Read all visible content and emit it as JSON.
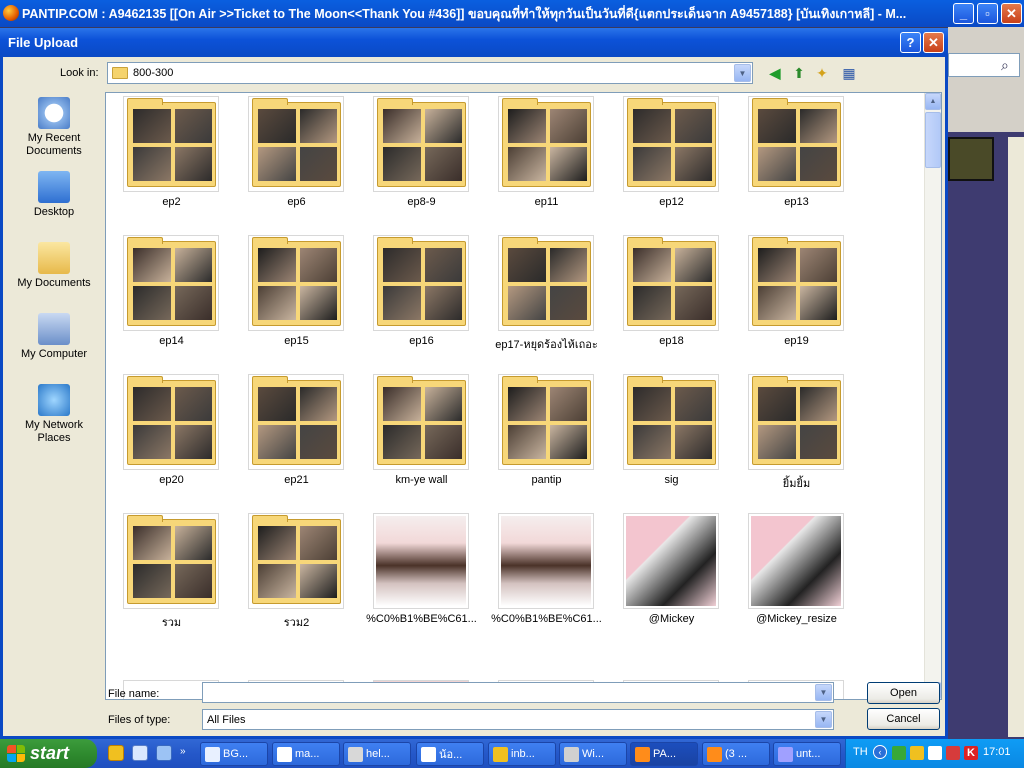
{
  "browser": {
    "title": "PANTIP.COM : A9462135 [[On Air >>Ticket to The Moon<<Thank You #436]] ขอบคุณที่ทำให้ทุกวันเป็นวันที่ดี{แตกประเด็นจาก A9457188} [บันเทิงเกาหลี] - M..."
  },
  "dialog": {
    "title": "File Upload",
    "help_btn": "?",
    "close_btn": "✕",
    "look_in_label": "Look in:",
    "look_in_value": "800-300",
    "file_name_label": "File name:",
    "file_name_value": "",
    "files_of_type_label": "Files of type:",
    "files_of_type_value": "All Files",
    "open_btn": "Open",
    "cancel_btn": "Cancel"
  },
  "places": [
    {
      "label": "My Recent Documents",
      "icon": "recent-documents-icon"
    },
    {
      "label": "Desktop",
      "icon": "desktop-icon"
    },
    {
      "label": "My Documents",
      "icon": "my-documents-icon"
    },
    {
      "label": "My Computer",
      "icon": "my-computer-icon"
    },
    {
      "label": "My Network Places",
      "icon": "network-places-icon"
    }
  ],
  "files": [
    {
      "name": "ep2",
      "kind": "folder"
    },
    {
      "name": "ep6",
      "kind": "folder"
    },
    {
      "name": "ep8-9",
      "kind": "folder"
    },
    {
      "name": "ep11",
      "kind": "folder"
    },
    {
      "name": "ep12",
      "kind": "folder"
    },
    {
      "name": "ep13",
      "kind": "folder"
    },
    {
      "name": "ep14",
      "kind": "folder"
    },
    {
      "name": "ep15",
      "kind": "folder"
    },
    {
      "name": "ep16",
      "kind": "folder"
    },
    {
      "name": "ep17-หยุดร้องไห้เถอะ",
      "kind": "folder"
    },
    {
      "name": "ep18",
      "kind": "folder"
    },
    {
      "name": "ep19",
      "kind": "folder"
    },
    {
      "name": "ep20",
      "kind": "folder"
    },
    {
      "name": "ep21",
      "kind": "folder"
    },
    {
      "name": "km-ye wall",
      "kind": "folder"
    },
    {
      "name": "pantip",
      "kind": "folder"
    },
    {
      "name": "sig",
      "kind": "folder"
    },
    {
      "name": "ยิ้มยิ้ม",
      "kind": "folder"
    },
    {
      "name": "รวม",
      "kind": "folder"
    },
    {
      "name": "รวม2",
      "kind": "folder"
    },
    {
      "name": "%C0%B1%BE%C61...",
      "kind": "image"
    },
    {
      "name": "%C0%B1%BE%C61...",
      "kind": "image"
    },
    {
      "name": "@Mickey",
      "kind": "image"
    },
    {
      "name": "@Mickey_resize",
      "kind": "image"
    }
  ],
  "taskbar": {
    "start_label": "start",
    "tasks": [
      {
        "label": "BG...",
        "active": false
      },
      {
        "label": "ma...",
        "active": false
      },
      {
        "label": "hel...",
        "active": false
      },
      {
        "label": "น้อ...",
        "active": false
      },
      {
        "label": "inb...",
        "active": false
      },
      {
        "label": "Wi...",
        "active": false
      },
      {
        "label": "PA...",
        "active": true
      },
      {
        "label": "(3 ...",
        "active": false
      },
      {
        "label": "unt...",
        "active": false
      }
    ],
    "language": "TH",
    "clock": "17:01"
  }
}
